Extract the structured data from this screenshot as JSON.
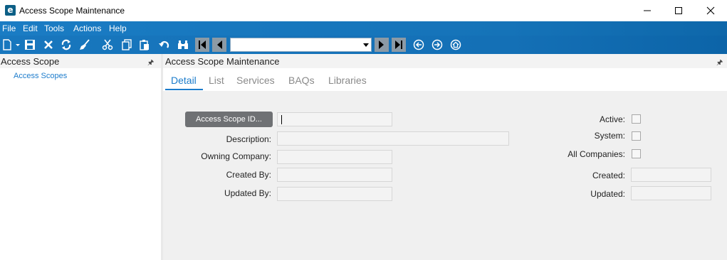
{
  "window": {
    "app_icon_letter": "e",
    "title": "Access Scope Maintenance"
  },
  "menu": [
    "File",
    "Edit",
    "Tools",
    "Actions",
    "Help"
  ],
  "toolbar": {
    "icons": [
      "new-icon",
      "save-icon",
      "delete-icon",
      "refresh-icon",
      "clear-icon",
      "cut-icon",
      "copy-icon",
      "paste-icon",
      "undo-icon",
      "search-binoculars-icon"
    ],
    "record_selector_value": "",
    "nav_icons": [
      "first-record-icon",
      "previous-record-icon",
      "next-record-icon",
      "last-record-icon",
      "back-icon",
      "forward-icon",
      "home-icon"
    ]
  },
  "left_pane": {
    "title": "Access Scope",
    "tree_items": [
      "Access Scopes"
    ]
  },
  "main": {
    "title": "Access Scope Maintenance",
    "tabs": [
      "Detail",
      "List",
      "Services",
      "BAQs",
      "Libraries"
    ],
    "active_tab": "Detail",
    "form": {
      "access_scope_button": "Access Scope ID...",
      "access_scope_id": "",
      "description_label": "Description:",
      "description": "",
      "owning_company_label": "Owning Company:",
      "owning_company": "",
      "created_by_label": "Created By:",
      "created_by": "",
      "updated_by_label": "Updated By:",
      "updated_by": "",
      "active_label": "Active:",
      "active": false,
      "system_label": "System:",
      "system": false,
      "all_companies_label": "All Companies:",
      "all_companies": false,
      "created_label": "Created:",
      "created": "",
      "updated_label": "Updated:",
      "updated": ""
    }
  },
  "colors": {
    "menu_bar": "#1a7cc4",
    "accent": "#1b7ccb",
    "form_background": "#f0f0f0"
  }
}
